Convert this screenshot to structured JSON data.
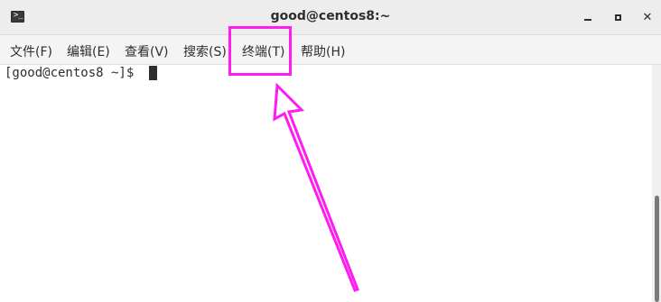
{
  "window": {
    "title": "good@centos8:~",
    "icon": "terminal-icon",
    "controls": [
      "minimize-icon",
      "maximize-icon",
      "close-icon"
    ],
    "close_glyph": "✕"
  },
  "menu": {
    "items": [
      {
        "label": "文件(F)"
      },
      {
        "label": "编辑(E)"
      },
      {
        "label": "查看(V)"
      },
      {
        "label": "搜索(S)"
      },
      {
        "label": "终端(T)"
      },
      {
        "label": "帮助(H)"
      }
    ]
  },
  "terminal": {
    "prompt": "[good@centos8 ~]$ "
  },
  "annotation": {
    "color": "#ff1cf2",
    "target": "终端(T)"
  }
}
